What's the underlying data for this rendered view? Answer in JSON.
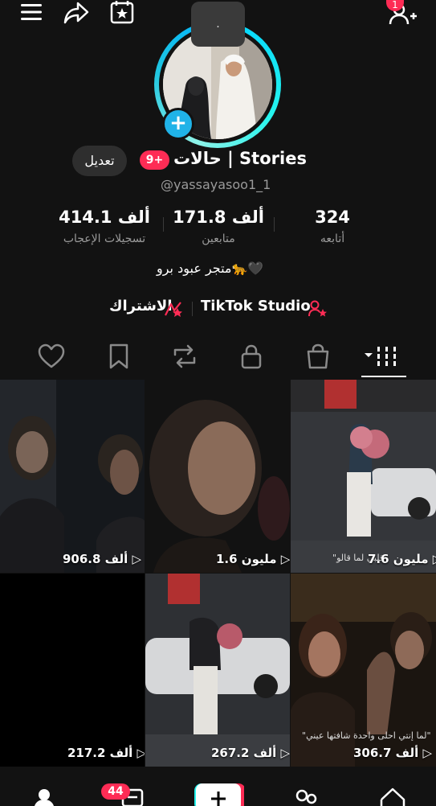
{
  "profile": {
    "note": ".",
    "edit_label": "تعديل",
    "name": "حالات | Stories",
    "stories_badge": "9+",
    "handle": "@yassayasoo1_1",
    "stats": [
      {
        "value": "414.1 ألف",
        "label": "تسجيلات الإعجاب"
      },
      {
        "value": "171.8 ألف",
        "label": "متابعين"
      },
      {
        "value": "324",
        "label": "أتابعه"
      }
    ],
    "bio": "متجر عبود برو🐆🖤",
    "subscribe_label": "الاشتراك",
    "studio_label": "TikTok Studio"
  },
  "header": {
    "notification_count": "1"
  },
  "tabs": [
    "videos-grid",
    "shop",
    "private",
    "reposts",
    "favorites",
    "liked"
  ],
  "videos": [
    {
      "views": "906.8 ألف",
      "caption": ""
    },
    {
      "views": "1.6 مليون",
      "caption": ""
    },
    {
      "views": "7.6 مليون",
      "caption": "\"قلبي لما قالو"
    },
    {
      "views": "217.2 ألف",
      "caption": ""
    },
    {
      "views": "267.2 ألف",
      "caption": ""
    },
    {
      "views": "306.7 ألف",
      "caption": "\"لما إنتي احلى واحدة شافتها عيني\""
    }
  ],
  "bottom_nav": {
    "inbox_badge": "44"
  },
  "colors": {
    "accent": "#fe2c55",
    "ring": "#25f4ee",
    "background": "#121212"
  }
}
